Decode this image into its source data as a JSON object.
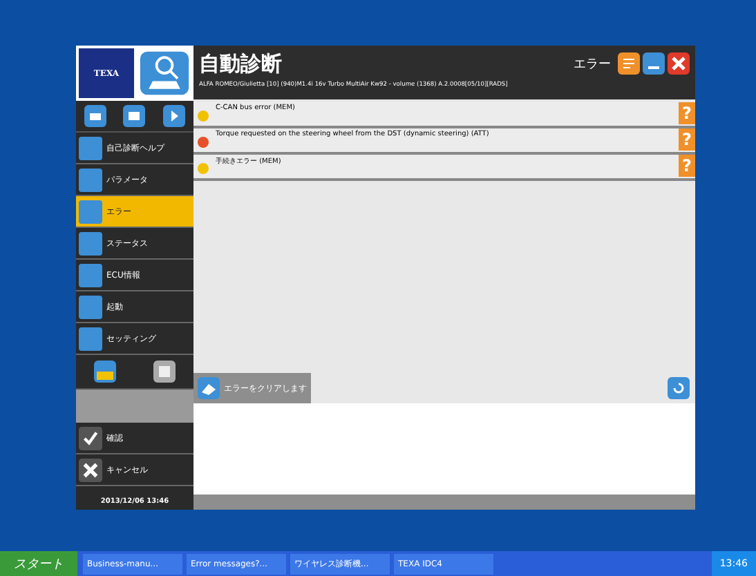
{
  "window": {
    "title": "自動診断",
    "logo": "TEXA",
    "section": "エラー"
  },
  "vehicle": "ALFA ROMEO/Giulietta [10] (940)M1.4i 16v Turbo MultiAir Kw92 - volume (1368) A.2.0008[05/10][RADS]",
  "errors": [
    {
      "text": "C-CAN bus error (MEM)",
      "color": "#f2c200",
      "help": "?"
    },
    {
      "text": "Torque requested on the steering wheel from the DST (dynamic steering) (ATT)",
      "color": "#e8502a",
      "help": "?"
    },
    {
      "text": "手続きエラー (MEM)",
      "color": "#f2c200",
      "help": "?"
    }
  ],
  "sidebar": {
    "items": [
      {
        "label": "自己診断ヘルプ",
        "selected": false
      },
      {
        "label": "パラメータ",
        "selected": false
      },
      {
        "label": "エラー",
        "selected": true
      },
      {
        "label": "ステータス",
        "selected": false
      },
      {
        "label": "ECU情報",
        "selected": false
      },
      {
        "label": "起動",
        "selected": false
      },
      {
        "label": "セッティング",
        "selected": false
      }
    ],
    "actions": [
      "確認",
      "キャンセル"
    ],
    "datetime": "2013/12/06 13:46"
  },
  "clear_button": "エラーをクリアします",
  "taskbar": {
    "start": "スタート",
    "items": [
      "Business-manu...",
      "Error messages?...",
      "ワイヤレス診断機...",
      "TEXA IDC4"
    ],
    "clock": "13:46"
  }
}
